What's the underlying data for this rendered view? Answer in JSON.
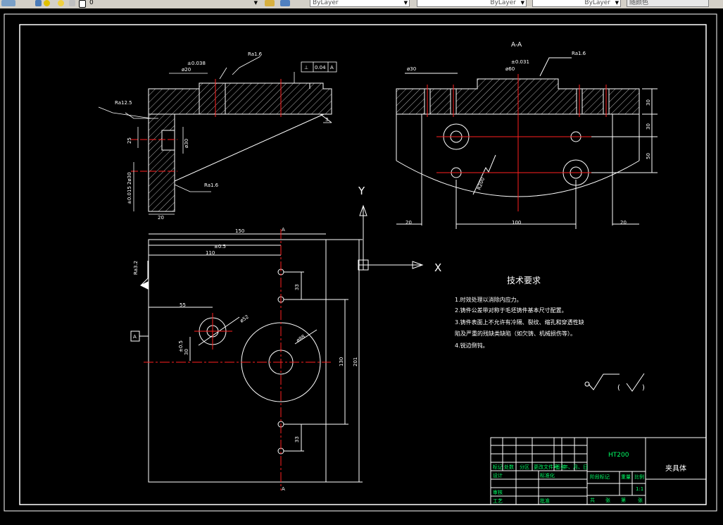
{
  "toolbar": {
    "layer_value": "0",
    "color_value": "ByLayer",
    "linetype_value": "ByLayer",
    "lineweight_value": "ByLayer",
    "plotstyle_value": "随颜色"
  },
  "drawing": {
    "section_label": "A-A",
    "roughness_top_left": "Ra1.6",
    "roughness_mid_left": "Ra12.5",
    "roughness_left_bottom": "Ra1.6",
    "roughness_section": "Ra1.6",
    "roughness_plan": "Ra3.2",
    "tol_top_left": "±0.038",
    "dia_top_left": "ø20",
    "gdt_symbol": "⊥",
    "gdt_value": "0.04",
    "gdt_datum": "A",
    "dim_plan_width": "150",
    "dim_plan_tol": "±0.5",
    "dim_plan_110": "110",
    "dim_plan_55": "55",
    "dim_plan_33a": "33",
    "dim_plan_33b": "33",
    "dim_plan_130": "130",
    "dim_plan_201": "201",
    "dim_plan_30": "30",
    "dim_plan_tol2": "±0.5",
    "dim_plan_phi52": "ø52",
    "dim_plan_phi88": "ø88",
    "dim_sec_tol": "±0.031",
    "dim_sec_phi": "ø30",
    "dim_sec_phi2": "ø60",
    "dim_sec_20a": "20",
    "dim_sec_100": "100",
    "dim_sec_20b": "20",
    "dim_sec_30a": "30",
    "dim_sec_30b": "30",
    "dim_sec_50": "50",
    "dim_sec_r": "R200",
    "dim_side_20": "20",
    "dim_side_tol": "±0.015",
    "dim_side_2phi": "2ø30",
    "dim_side_25": "25",
    "dim_side_3": "3",
    "datum_a": "A",
    "ucs_x": "X",
    "ucs_y": "Y"
  },
  "notes": {
    "title": "技术要求",
    "items": [
      "1.时效处理以消除内应力。",
      "2.铸件公差带对称于毛坯铸件基本尺寸配置。",
      "3.铸件表面上不允许有冷隔、裂纹、缩孔和穿透性缺",
      "陷及严重的残缺类缺陷（如欠铸、机械损伤等）。",
      "4.锐边倒钝。"
    ]
  },
  "title_block": {
    "material": "HT200",
    "part_name": "夹具体",
    "scale": "1:1",
    "row_labels": [
      "标记",
      "处数",
      "分区",
      "更改文件号",
      "签名",
      "年、月、日"
    ],
    "design": "设计",
    "standardize": "标准化",
    "stage_mark": "阶段标记",
    "weight": "重量",
    "ratio": "比例",
    "review": "审核",
    "process": "工艺",
    "approve": "批准",
    "sheets": [
      "共",
      "张",
      "第",
      "张"
    ]
  },
  "colors": {
    "line": "#ffffff",
    "center": "#ff2020",
    "text": "#ffffff",
    "green_text": "#00ff66",
    "toolbar_bg": "#d4d0c8"
  }
}
